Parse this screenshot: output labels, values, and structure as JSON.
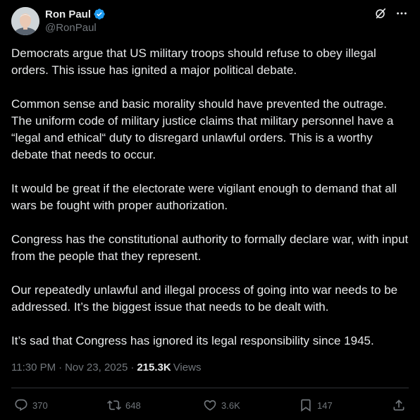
{
  "author": {
    "display_name": "Ron Paul",
    "handle": "@RonPaul",
    "verified_color": "#1d9bf0"
  },
  "top_actions": {
    "grok_icon": "grok-icon",
    "more_icon": "more-icon"
  },
  "tweet": {
    "paragraphs": [
      "Democrats argue that US military troops should refuse to obey illegal orders. This issue has ignited a major political debate.",
      "Common sense and basic morality should have prevented the outrage. The uniform code of military justice claims that military personnel have a “legal and ethical“ duty to disregard unlawful orders. This is a worthy debate that needs to occur.",
      "It would be great if the electorate were vigilant enough to demand that all wars be fought with proper authorization.",
      "Congress has the constitutional authority to formally declare war, with input from the people that they represent.",
      "Our repeatedly unlawful and illegal process of going into war needs to be addressed. It’s the biggest issue that needs to be dealt with.",
      "It’s sad that Congress has ignored its legal responsibility since 1945."
    ]
  },
  "meta": {
    "time": "11:30 PM",
    "separator": "·",
    "date": "Nov 23, 2025",
    "views_count": "215.3K",
    "views_label": "Views"
  },
  "actions": {
    "replies": "370",
    "retweets": "648",
    "likes": "3.6K",
    "bookmarks": "147"
  },
  "colors": {
    "background": "#000000",
    "text": "#e7e9ea",
    "muted": "#71767b",
    "divider": "#2f3336",
    "accent": "#1d9bf0"
  }
}
